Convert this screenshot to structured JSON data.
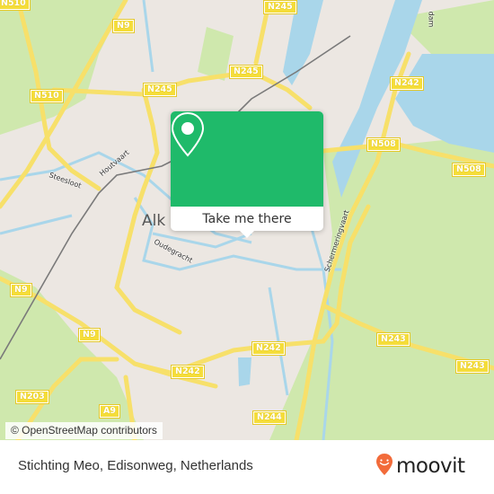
{
  "map": {
    "colors": {
      "land": "#ece7e2",
      "green": "#cfe8ad",
      "water": "#a9d6ea",
      "road": "#f7e06a",
      "rail": "#7a7a7a",
      "accent": "#1fba6a"
    },
    "city_label": "Alk",
    "road_labels": [
      {
        "id": "n510-top",
        "text": "N510"
      },
      {
        "id": "n9-top",
        "text": "N9"
      },
      {
        "id": "n245-top",
        "text": "N245"
      },
      {
        "id": "n510",
        "text": "N510"
      },
      {
        "id": "n245-mid",
        "text": "N245"
      },
      {
        "id": "n245-left",
        "text": "N245"
      },
      {
        "id": "n242-top",
        "text": "N242"
      },
      {
        "id": "n508-left",
        "text": "N508"
      },
      {
        "id": "n508-right",
        "text": "N508"
      },
      {
        "id": "n9-left",
        "text": "N9"
      },
      {
        "id": "n9-mid",
        "text": "N9"
      },
      {
        "id": "n242-mid",
        "text": "N242"
      },
      {
        "id": "n242-left",
        "text": "N242"
      },
      {
        "id": "n243-a",
        "text": "N243"
      },
      {
        "id": "n243-b",
        "text": "N243"
      },
      {
        "id": "n203",
        "text": "N203"
      },
      {
        "id": "a9",
        "text": "A9"
      },
      {
        "id": "n244",
        "text": "N244"
      }
    ],
    "street_labels": [
      {
        "id": "houtvaart",
        "text": "Houtvaart"
      },
      {
        "id": "steesloot",
        "text": "Steesloot"
      },
      {
        "id": "oudegracht",
        "text": "Oudegracht"
      },
      {
        "id": "schermeringvaart",
        "text": "Schermeringvaart"
      },
      {
        "id": "top-right",
        "text": "dam"
      }
    ],
    "attribution": "© OpenStreetMap contributors"
  },
  "popup": {
    "icon": "map-pin-icon",
    "button_label": "Take me there"
  },
  "footer": {
    "address": "Stichting Meo, Edisonweg, Netherlands",
    "brand": "moovit",
    "brand_icon": "moovit-smiley-pin-icon",
    "brand_color": "#f26b3a"
  }
}
